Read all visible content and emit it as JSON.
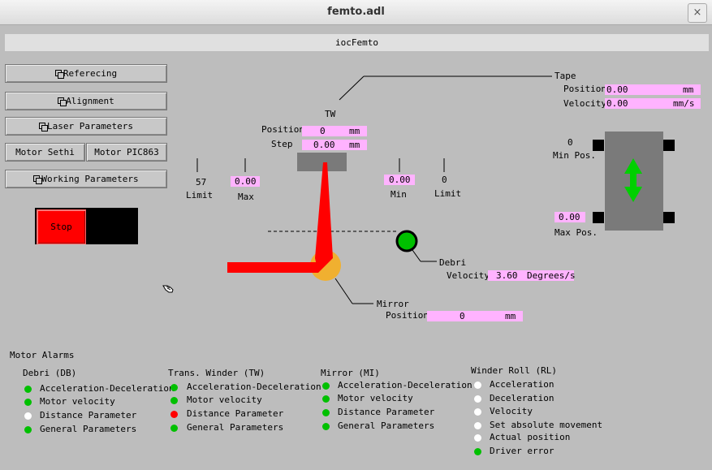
{
  "window": {
    "title": "femto.adl",
    "close_glyph": "×"
  },
  "header": {
    "title": "iocFemto"
  },
  "buttons": {
    "referecing": "Referecing",
    "alignment": "Alignment",
    "laser_parameters": "Laser Parameters",
    "motor_sethi": "Motor Sethi",
    "motor_pic863": "Motor PIC863",
    "working_parameters": "Working Parameters",
    "stop": "Stop"
  },
  "tape": {
    "label": "Tape",
    "position_label": "Position",
    "position_value": "0.00",
    "position_unit": "mm",
    "velocity_label": "Velocity",
    "velocity_value": "0.00",
    "velocity_unit": "mm/s"
  },
  "tw": {
    "label": "TW",
    "position_label": "Position",
    "position_value": "0",
    "position_unit": "mm",
    "step_label": "Step",
    "step_value": "0.00",
    "step_unit": "mm"
  },
  "limits": {
    "left_limit_value": "57",
    "left_limit_label": "Limit",
    "max_value": "0.00",
    "max_label": "Max",
    "min_value": "0.00",
    "min_label": "Min",
    "right_limit_value": "0",
    "right_limit_label": "Limit"
  },
  "winder": {
    "min_pos_value": "0",
    "min_pos_label": "Min Pos.",
    "max_pos_value": "0.00",
    "max_pos_label": "Max Pos."
  },
  "debri": {
    "label": "Debri",
    "velocity_label": "Velocity",
    "velocity_value": "3.60",
    "velocity_unit": "Degrees/s"
  },
  "mirror": {
    "label": "Mirror",
    "position_label": "Position",
    "position_value": "0",
    "position_unit": "mm"
  },
  "alarms": {
    "title": "Motor Alarms",
    "groups": [
      {
        "title": "Debri (DB)",
        "items": [
          {
            "label": "Acceleration-Deceleration",
            "color": "#00c000"
          },
          {
            "label": "Motor velocity",
            "color": "#00c000"
          },
          {
            "label": "Distance Parameter",
            "color": "#ffffff"
          },
          {
            "label": "General Parameters",
            "color": "#00c000"
          }
        ]
      },
      {
        "title": "Trans. Winder (TW)",
        "items": [
          {
            "label": "Acceleration-Deceleration",
            "color": "#00c000"
          },
          {
            "label": "Motor velocity",
            "color": "#00c000"
          },
          {
            "label": "Distance Parameter",
            "color": "#ff0000"
          },
          {
            "label": "General Parameters",
            "color": "#00c000"
          }
        ]
      },
      {
        "title": "Mirror (MI)",
        "items": [
          {
            "label": "Acceleration-Deceleration",
            "color": "#00c000"
          },
          {
            "label": "Motor velocity",
            "color": "#00c000"
          },
          {
            "label": "Distance Parameter",
            "color": "#00c000"
          },
          {
            "label": "General Parameters",
            "color": "#00c000"
          }
        ]
      },
      {
        "title": "Winder Roll (RL)",
        "items": [
          {
            "label": "Acceleration",
            "color": "#ffffff"
          },
          {
            "label": "Deceleration",
            "color": "#ffffff"
          },
          {
            "label": "Velocity",
            "color": "#ffffff"
          },
          {
            "label": "Set absolute movement",
            "color": "#ffffff"
          },
          {
            "label": "Actual position",
            "color": "#ffffff"
          },
          {
            "label": "Driver error",
            "color": "#00c000"
          }
        ]
      }
    ]
  },
  "colors": {
    "field_bg": "#ffb3ff",
    "beam": "#ff0000",
    "mirror": "#f0b030",
    "indicator_ok": "#00c000",
    "arrow": "#00d000"
  },
  "icons": {
    "related_display": "related-display-icon",
    "hand_cursor": "hand-cursor-icon"
  }
}
